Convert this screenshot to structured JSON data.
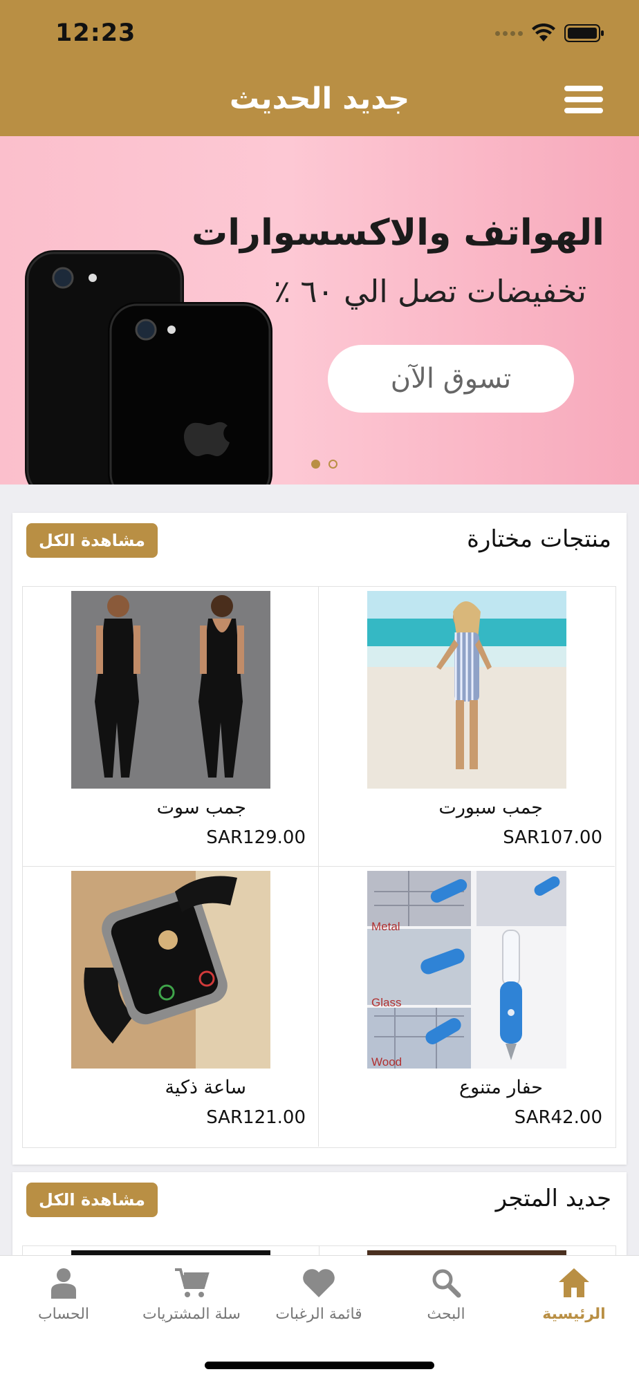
{
  "status_bar": {
    "time": "12:23"
  },
  "header": {
    "title": "جديد الحديث"
  },
  "banner": {
    "title": "الهواتف والاكسسوارات",
    "subtitle": "تخفيضات تصل الي ٦٠ ٪",
    "button_label": "تسوق الآن",
    "pager": {
      "count": 2,
      "active": 0
    }
  },
  "featured": {
    "title": "منتجات مختارة",
    "see_all_label": "مشاهدة الكل",
    "products": [
      {
        "name": "جمب سبورت",
        "price": "SAR107.00"
      },
      {
        "name": "جمب سوت",
        "price": "SAR129.00"
      },
      {
        "name": "حفار متنوع",
        "price": "SAR42.00"
      },
      {
        "name": "ساعة ذكية",
        "price": "SAR121.00"
      }
    ],
    "engraver_labels": [
      "Metal",
      "Glass",
      "Wood"
    ]
  },
  "new_store": {
    "title": "جديد المتجر",
    "see_all_label": "مشاهدة الكل"
  },
  "tabbar": {
    "items": [
      {
        "label": "الرئيسية",
        "icon": "home-icon",
        "active": true
      },
      {
        "label": "البحث",
        "icon": "search-icon"
      },
      {
        "label": "قائمة الرغبات",
        "icon": "heart-icon"
      },
      {
        "label": "سلة المشتريات",
        "icon": "cart-icon"
      },
      {
        "label": "الحساب",
        "icon": "user-icon"
      }
    ]
  },
  "colors": {
    "accent": "#b98f44",
    "banner_pink": "#fbbfcc",
    "background": "#eeeef2"
  }
}
